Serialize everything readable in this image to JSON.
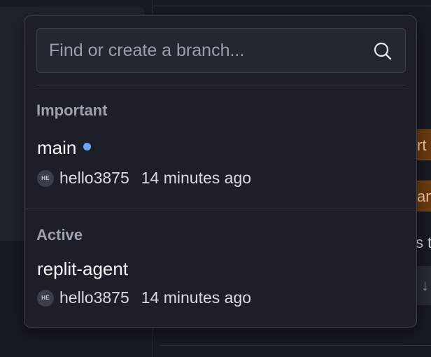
{
  "background": {
    "orange_button_1_text": "rt",
    "orange_button_2_text": "an",
    "partial_text": "s t",
    "arrow_button_icon": "↓"
  },
  "search": {
    "placeholder": "Find or create a branch...",
    "value": "",
    "icon": "search-icon"
  },
  "sections": {
    "important": {
      "label": "Important",
      "branches": [
        {
          "name": "main",
          "is_current": true,
          "avatar_initials": "HE",
          "author": "hello3875",
          "updated": "14 minutes ago"
        }
      ]
    },
    "active": {
      "label": "Active",
      "branches": [
        {
          "name": "replit-agent",
          "is_current": false,
          "avatar_initials": "HE",
          "author": "hello3875",
          "updated": "14 minutes ago"
        }
      ]
    }
  },
  "colors": {
    "background": "#161a22",
    "popover": "#1c1f27",
    "current_dot": "#6aa8ff",
    "accent_orange": "#6b3a0f"
  }
}
